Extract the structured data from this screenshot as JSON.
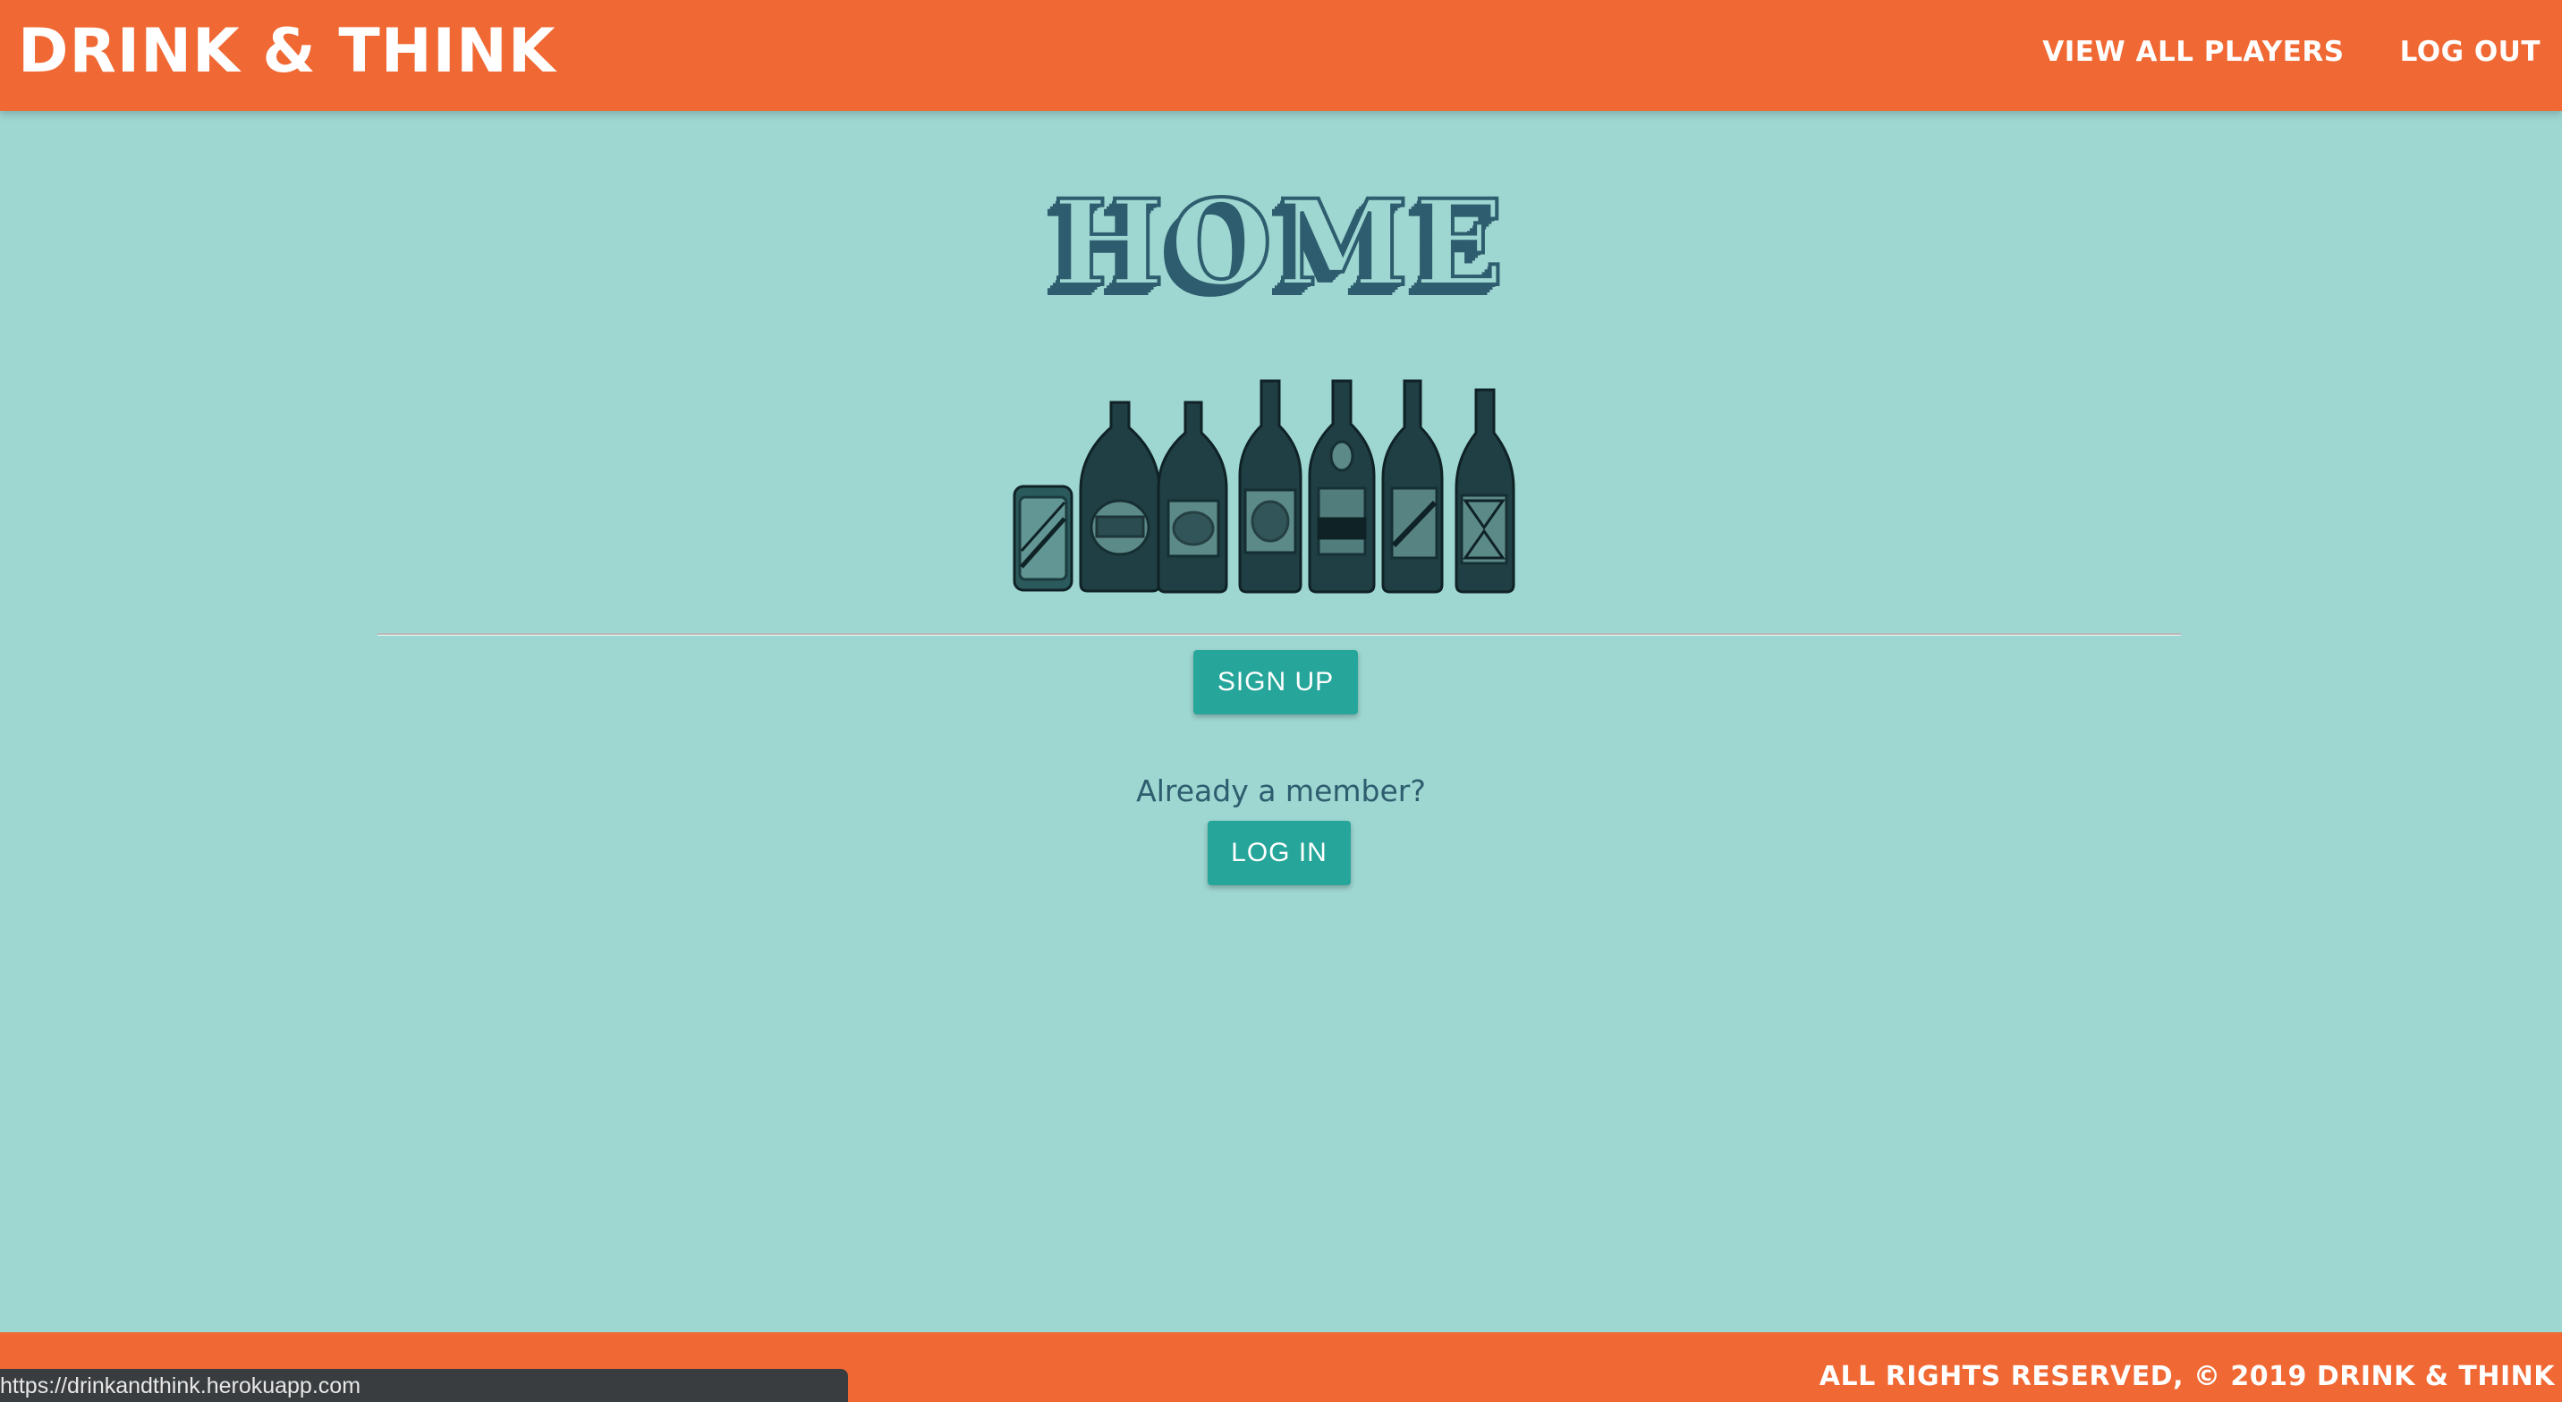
{
  "navbar": {
    "brand": "DRINK & THINK",
    "links": [
      {
        "label": "VIEW ALL PLAYERS"
      },
      {
        "label": "LOG OUT"
      }
    ],
    "background_color": "#f06833"
  },
  "main": {
    "heading": "HOME",
    "illustration_icon": "beer-bottles-icon",
    "signup_label": "SIGN UP",
    "member_prompt": "Already a member?",
    "login_label": "LOG IN",
    "background_color": "#9ed6d1",
    "button_color": "#26a69a",
    "heading_color": "#2d5d6e"
  },
  "footer": {
    "text": "ALL RIGHTS RESERVED, © 2019 DRINK & THINK"
  },
  "status_bar": {
    "url": "https://drinkandthink.herokuapp.com"
  }
}
